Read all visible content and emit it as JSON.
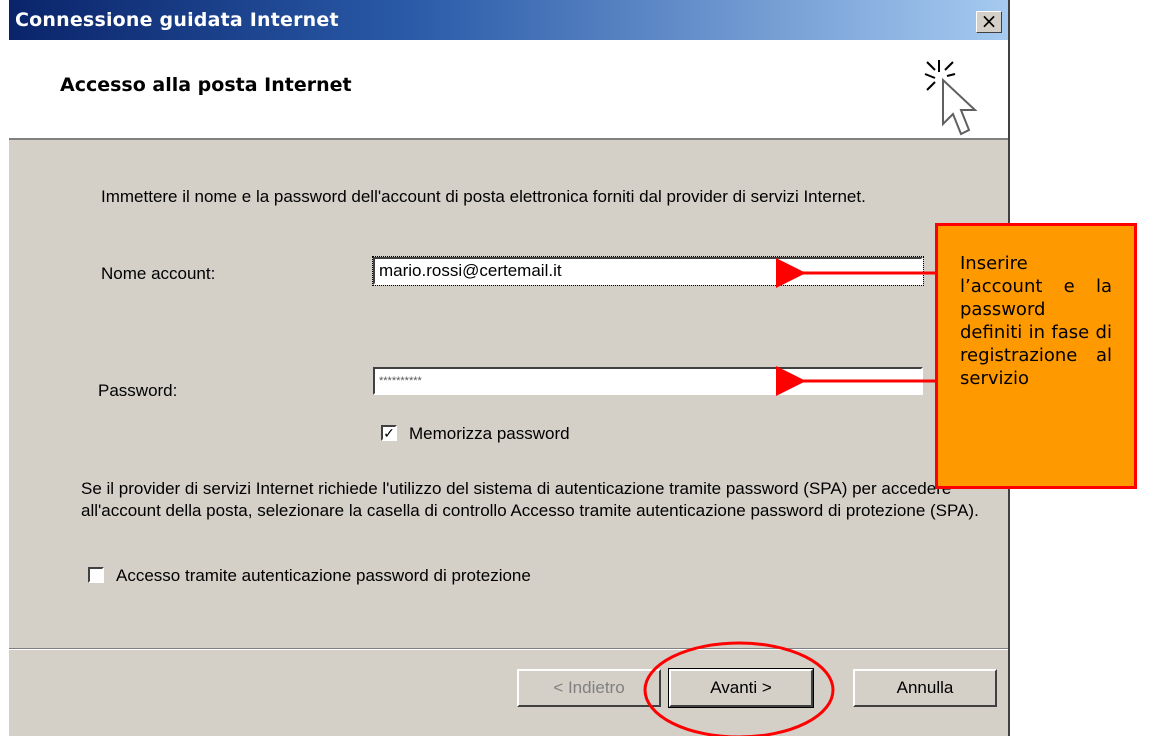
{
  "window": {
    "title": "Connessione guidata Internet",
    "close_glyph": "×"
  },
  "header": {
    "title": "Accesso alla posta Internet"
  },
  "content": {
    "intro": "Immettere il nome e la password dell'account di posta elettronica forniti dal provider di servizi Internet.",
    "account_label": "Nome account:",
    "account_value": "mario.rossi@certemail.it",
    "password_label": "Password:",
    "password_value": "**********",
    "remember_label": "Memorizza password",
    "remember_checked": true,
    "spa_text": "Se il provider di servizi Internet richiede l'utilizzo del sistema di autenticazione tramite password (SPA) per accedere all'account della posta, selezionare la casella di controllo Accesso tramite autenticazione password di protezione (SPA).",
    "spa_label": "Accesso tramite autenticazione password di protezione",
    "spa_checked": false
  },
  "buttons": {
    "back": "< Indietro",
    "next": "Avanti >",
    "cancel": "Annulla"
  },
  "callout": {
    "text": "Inserire l’account e la password definiti in fase di registrazione al servizio"
  },
  "colors": {
    "callout_fill": "#ff9900",
    "annotation": "#ff0000",
    "titlebar": "#0a246a"
  },
  "icons": {
    "wizard": "wizard-cursor-icon",
    "check": "checkmark-icon"
  }
}
